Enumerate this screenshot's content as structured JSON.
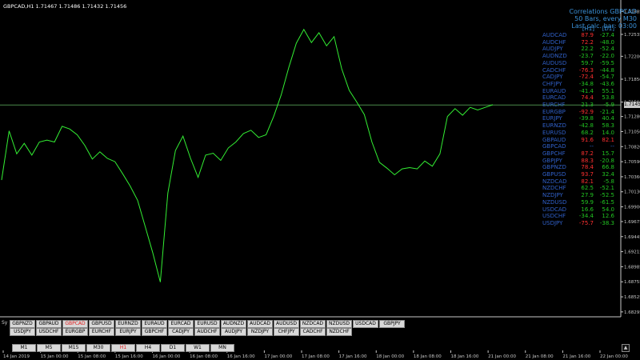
{
  "symbol_info": "GBPCAD,H1  1.71467 1.71486 1.71432 1.71456",
  "price_axis": [
    "1.72885",
    "1.72535",
    "1.72200",
    "1.71850",
    "1.71500",
    "1.71280",
    "1.71050",
    "1.70820",
    "1.70590",
    "1.70360",
    "1.70130",
    "1.69900",
    "1.69675",
    "1.69445",
    "1.69215",
    "1.68985",
    "1.68755",
    "1.68525",
    "1.68295"
  ],
  "time_axis": [
    "14 Jan 2019",
    "15 Jan 00:00",
    "15 Jan 08:00",
    "15 Jan 16:00",
    "16 Jan 00:00",
    "16 Jan 08:00",
    "16 Jan 16:00",
    "17 Jan 00:00",
    "17 Jan 08:00",
    "17 Jan 16:00",
    "18 Jan 00:00",
    "18 Jan 08:00",
    "18 Jan 16:00",
    "21 Jan 00:00",
    "21 Jan 08:00",
    "21 Jan 16:00",
    "22 Jan 00:00"
  ],
  "current_price": "1.71456",
  "colors": {
    "line": "#33ee33",
    "axis": "#c8c8c8",
    "hline": "#4a8a4a",
    "positive": "#22c522",
    "negative": "#ff3030",
    "symbol": "#3060c8",
    "header": "#3a8fd6"
  },
  "chart_data": {
    "type": "line",
    "title": "",
    "xlabel": "",
    "ylabel": "",
    "ylim": [
      1.6822,
      1.7306
    ],
    "categories": [
      "14 Jan 2019",
      "15 Jan 00:00",
      "15 Jan 08:00",
      "15 Jan 16:00",
      "16 Jan 00:00",
      "16 Jan 08:00",
      "16 Jan 16:00",
      "17 Jan 00:00",
      "17 Jan 08:00",
      "17 Jan 16:00",
      "18 Jan 00:00",
      "18 Jan 08:00",
      "18 Jan 16:00",
      "21 Jan 00:00",
      "21 Jan 08:00",
      "21 Jan 16:00",
      "22 Jan 00:00"
    ],
    "series": [
      {
        "values": [
          1.7031,
          1.7106,
          1.7071,
          1.7087,
          1.7069,
          1.7089,
          1.7092,
          1.7089,
          1.7113,
          1.7109,
          1.71,
          1.7084,
          1.7063,
          1.7074,
          1.7064,
          1.7059,
          1.7041,
          1.7022,
          1.7,
          1.696,
          1.692,
          1.6875,
          1.7011,
          1.7076,
          1.7098,
          1.7064,
          1.7035,
          1.7069,
          1.7072,
          1.7061,
          1.708,
          1.7089,
          1.7102,
          1.7107,
          1.7096,
          1.71,
          1.7128,
          1.7161,
          1.7203,
          1.724,
          1.7261,
          1.7241,
          1.7256,
          1.7236,
          1.725,
          1.7201,
          1.7168,
          1.715,
          1.7131,
          1.7089,
          1.7058,
          1.7049,
          1.7039,
          1.7048,
          1.705,
          1.7048,
          1.706,
          1.7052,
          1.7071,
          1.7128,
          1.714,
          1.713,
          1.7142,
          1.7138,
          1.7142,
          1.7146
        ]
      }
    ]
  },
  "correlations": {
    "title": "Correlations GBPCAD",
    "bars": "50  Bars, every M30",
    "last_calc": "Last calc. bar: 03:00",
    "col1": "[H1]",
    "col2": "[D1]",
    "rows": [
      {
        "sym": "AUDCAD",
        "h1": "87.9",
        "d1": "-27.4"
      },
      {
        "sym": "AUDCHF",
        "h1": "72.2",
        "d1": "-48.0"
      },
      {
        "sym": "AUDJPY",
        "h1": "22.2",
        "d1": "-52.4"
      },
      {
        "sym": "AUDNZD",
        "h1": "-23.7",
        "d1": "-22.0"
      },
      {
        "sym": "AUDUSD",
        "h1": "59.7",
        "d1": "-59.5"
      },
      {
        "sym": "CADCHF",
        "h1": "-76.3",
        "d1": "-44.8"
      },
      {
        "sym": "CADJPY",
        "h1": "-72.4",
        "d1": "-54.7"
      },
      {
        "sym": "CHFJPY",
        "h1": "-34.8",
        "d1": "-43.6"
      },
      {
        "sym": "EURAUD",
        "h1": "-41.4",
        "d1": "55.1"
      },
      {
        "sym": "EURCAD",
        "h1": "74.4",
        "d1": "53.8"
      },
      {
        "sym": "EURCHF",
        "h1": "21.3",
        "d1": "-5.9"
      },
      {
        "sym": "EURGBP",
        "h1": "-92.9",
        "d1": "-21.4"
      },
      {
        "sym": "EURJPY",
        "h1": "-39.8",
        "d1": "40.4"
      },
      {
        "sym": "EURNZD",
        "h1": "-42.8",
        "d1": "58.3"
      },
      {
        "sym": "EURUSD",
        "h1": "68.2",
        "d1": "14.0"
      },
      {
        "sym": "GBPAUD",
        "h1": "91.6",
        "d1": "82.1"
      },
      {
        "sym": "GBPCAD",
        "h1": "--",
        "d1": "--"
      },
      {
        "sym": "GBPCHF",
        "h1": "87.2",
        "d1": "15.7"
      },
      {
        "sym": "GBPJPY",
        "h1": "88.3",
        "d1": "-20.8"
      },
      {
        "sym": "GBPNZD",
        "h1": "78.4",
        "d1": "66.8"
      },
      {
        "sym": "GBPUSD",
        "h1": "93.7",
        "d1": "32.4"
      },
      {
        "sym": "NZDCAD",
        "h1": "82.1",
        "d1": "-5.8"
      },
      {
        "sym": "NZDCHF",
        "h1": "62.5",
        "d1": "-52.1"
      },
      {
        "sym": "NZDJPY",
        "h1": "27.9",
        "d1": "-52.5"
      },
      {
        "sym": "NZDUSD",
        "h1": "59.9",
        "d1": "-61.5"
      },
      {
        "sym": "USDCAD",
        "h1": "16.6",
        "d1": "54.0"
      },
      {
        "sym": "USDCHF",
        "h1": "-34.4",
        "d1": "12.6"
      },
      {
        "sym": "USDJPY",
        "h1": "-75.7",
        "d1": "-38.3"
      }
    ]
  },
  "sy_label": "Sy",
  "symbol_buttons_row1": [
    "GBPNZD",
    "GBPAUD",
    "GBPCAD",
    "GBPUSD",
    "EURNZD",
    "EURAUD",
    "EURCAD",
    "EURUSD",
    "AUDNZD",
    "AUDCAD",
    "AUDUSD",
    "NZDCAD",
    "NZDUSD",
    "USDCAD",
    "GBPJPY"
  ],
  "symbol_buttons_row2": [
    "USDJPY",
    "USDCHF",
    "EURGBP",
    "EURCHF",
    "EURJPY",
    "GBPCHF",
    "CADJPY",
    "AUDCHF",
    "AUDJPY",
    "NZDJPY",
    "CHFJPY",
    "CADCHF",
    "NZDCHF"
  ],
  "active_symbol": "GBPCAD",
  "timeframes": [
    "M1",
    "M5",
    "M15",
    "M30",
    "H1",
    "H4",
    "D1",
    "W1",
    "MN"
  ],
  "active_timeframe": "H1",
  "scroll_icon": "up-arrow-icon"
}
